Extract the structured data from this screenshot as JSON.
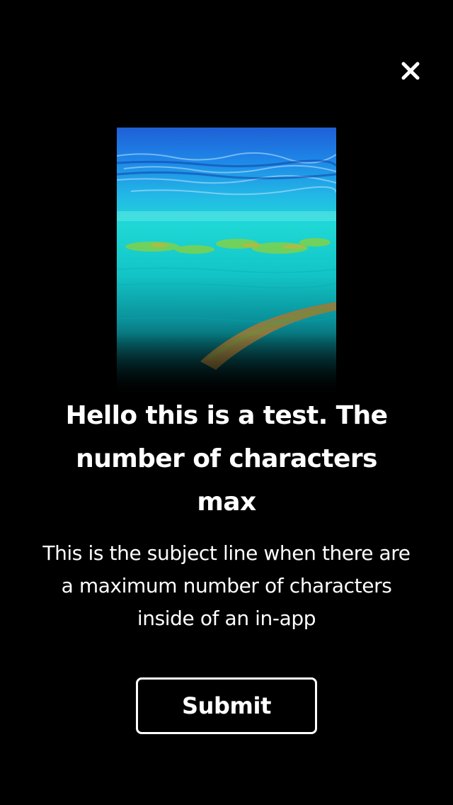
{
  "modal": {
    "close_icon": "close-icon",
    "hero_image": "ocean-reef-image",
    "headline": "Hello this is a test. The number of characters max",
    "subject": "This is the subject line when there are a maximum number of characters inside of an in-app",
    "submit_label": "Submit"
  },
  "colors": {
    "background": "#000000",
    "text": "#ffffff",
    "button_border": "#ffffff"
  }
}
